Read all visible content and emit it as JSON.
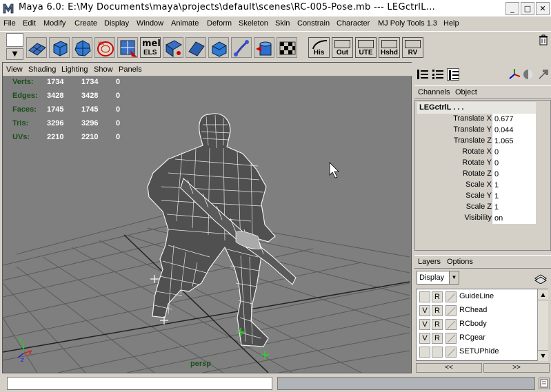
{
  "window": {
    "title": "Maya 6.0:  E:\\My Documents\\maya\\projects\\default\\scenes\\RC-005-Pose.mb   ---   LEGctrlL...",
    "minimize": "_",
    "maximize": "□",
    "close": "✕"
  },
  "menubar": [
    "File",
    "Edit",
    "Modify",
    "Create",
    "Display",
    "Window",
    "Animate",
    "Deform",
    "Skeleton",
    "Skin",
    "Constrain",
    "Character",
    "MJ Poly Tools 1.3",
    "Help"
  ],
  "shelf": {
    "icons": [
      "plane-icon",
      "cube-icon",
      "sphere-icon",
      "sphere-select-icon",
      "uv-icon",
      "mel-els-icon",
      "uv-map-icon",
      "plane2-icon",
      "cube2-icon",
      "joint-icon",
      "bucket-icon",
      "checker-icon"
    ],
    "mel_label": "mel",
    "els_label": "ELS",
    "text_buttons": [
      "His",
      "Out",
      "UTE",
      "Hshd",
      "RV"
    ]
  },
  "viewport": {
    "menu": [
      "View",
      "Shading",
      "Lighting",
      "Show",
      "Panels"
    ],
    "hud": {
      "rows": [
        {
          "label": "Verts:",
          "a": "1734",
          "b": "1734",
          "c": "0"
        },
        {
          "label": "Edges:",
          "a": "3428",
          "b": "3428",
          "c": "0"
        },
        {
          "label": "Faces:",
          "a": "1745",
          "b": "1745",
          "c": "0"
        },
        {
          "label": "Tris:",
          "a": "3296",
          "b": "3296",
          "c": "0"
        },
        {
          "label": "UVs:",
          "a": "2210",
          "b": "2210",
          "c": "0"
        }
      ]
    },
    "camera_label": "persp",
    "axis": {
      "y": "y",
      "z": "z",
      "x": "x"
    }
  },
  "channel_box": {
    "tabs": [
      "Channels",
      "Object"
    ],
    "node": "LEGctrlL . . .",
    "attributes": [
      {
        "name": "Translate X",
        "value": "0.677"
      },
      {
        "name": "Translate Y",
        "value": "0.044"
      },
      {
        "name": "Translate Z",
        "value": "1.065"
      },
      {
        "name": "Rotate X",
        "value": "0"
      },
      {
        "name": "Rotate Y",
        "value": "0"
      },
      {
        "name": "Rotate Z",
        "value": "0"
      },
      {
        "name": "Scale X",
        "value": "1"
      },
      {
        "name": "Scale Y",
        "value": "1"
      },
      {
        "name": "Scale Z",
        "value": "1"
      },
      {
        "name": "Visibility",
        "value": "on"
      }
    ]
  },
  "layers": {
    "tabs": [
      "Layers",
      "Options"
    ],
    "display_select": "Display",
    "items": [
      {
        "v": "",
        "r": "R",
        "name": "GuideLine"
      },
      {
        "v": "V",
        "r": "R",
        "name": "RChead"
      },
      {
        "v": "V",
        "r": "R",
        "name": "RCbody"
      },
      {
        "v": "V",
        "r": "R",
        "name": "RCgear"
      },
      {
        "v": "",
        "r": "",
        "name": "SETUPhide"
      }
    ],
    "nav_left": "<<",
    "nav_right": ">>"
  },
  "colors": {
    "viewport_bg": "#7f7f7f",
    "hud_label": "#1b4f1b",
    "grid": "#555555"
  }
}
